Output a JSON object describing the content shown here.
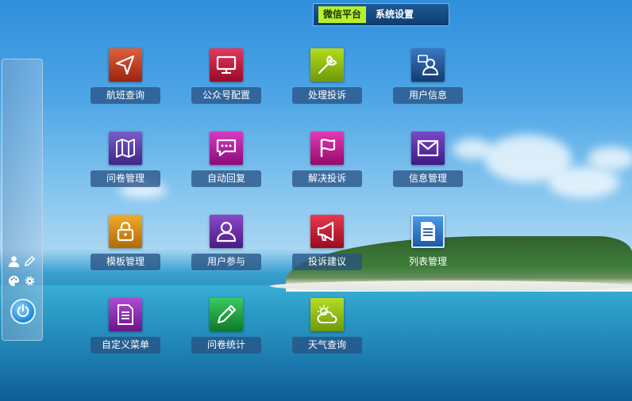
{
  "top_tabs": [
    {
      "label": "微信平台"
    },
    {
      "label": "系统设置"
    }
  ],
  "sidebar": {
    "icons": [
      "user-icon",
      "pencil-icon",
      "palette-icon",
      "gear-icon"
    ],
    "power": "power-icon"
  },
  "apps": [
    {
      "label": "航班查询",
      "icon": "navigation-arrow-icon",
      "color": "#c0391f"
    },
    {
      "label": "公众号配置",
      "icon": "monitor-icon",
      "color": "#c8103a"
    },
    {
      "label": "处理投诉",
      "icon": "wrench-icon",
      "color": "#8fb80f"
    },
    {
      "label": "用户信息",
      "icon": "user-card-icon",
      "color": "#1d4f8f"
    },
    {
      "label": "问卷管理",
      "icon": "map-icon",
      "color": "#5a3fa8"
    },
    {
      "label": "自动回复",
      "icon": "chat-bubble-icon",
      "color": "#b0179e"
    },
    {
      "label": "解决投诉",
      "icon": "flag-icon",
      "color": "#c41a8e"
    },
    {
      "label": "信息管理",
      "icon": "envelope-icon",
      "color": "#5b2fa4"
    },
    {
      "label": "模板管理",
      "icon": "lock-icon",
      "color": "#d98a10"
    },
    {
      "label": "用户参与",
      "icon": "user-icon",
      "color": "#6b2fa8"
    },
    {
      "label": "投诉建议",
      "icon": "megaphone-icon",
      "color": "#cc1a3a"
    },
    {
      "label": "列表管理",
      "icon": "document-icon",
      "color": "#2a72c8"
    },
    {
      "label": "自定义菜单",
      "icon": "list-document-icon",
      "color": "#8f2fb8"
    },
    {
      "label": "问卷统计",
      "icon": "pencil-icon",
      "color": "#1d9a3a"
    },
    {
      "label": "天气查询",
      "icon": "weather-icon",
      "color": "#8ab80f"
    }
  ]
}
